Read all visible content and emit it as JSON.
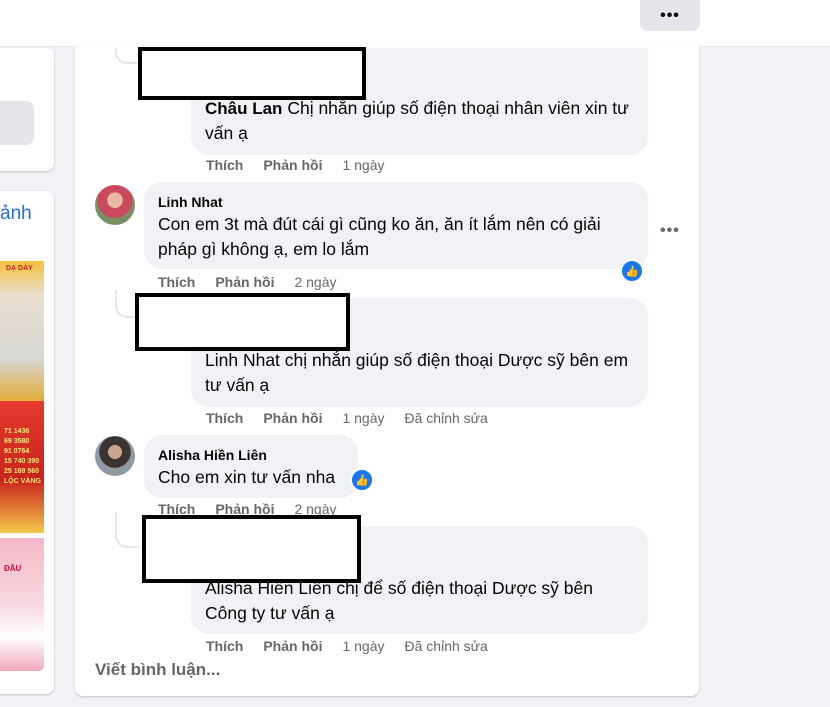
{
  "header": {
    "more_label": "•••"
  },
  "left_panel": {
    "card_text": "ảnh",
    "ads": [
      {
        "text": "DẠ DÀY"
      },
      {
        "text": "71 1436\n69 3580\n91 0764\n15 740 390\n25 169 560\nLỘC VÀNG"
      },
      {
        "text": "ĐẦU"
      }
    ]
  },
  "comments": [
    {
      "name": "Châu Lan",
      "text": "Chị nhắn giúp số điện thoại nhân viên xin tư vấn ạ",
      "actions": [
        "Thích",
        "Phản hồi"
      ],
      "time": "1 ngày"
    },
    {
      "name": "Linh Nhat",
      "text": "Con em 3t mà đút cái gì cũng ko ăn, ăn ít lắm nên có giải pháp gì không ạ, em lo lắm",
      "actions": [
        "Thích",
        "Phản hồi"
      ],
      "time": "2 ngày",
      "options_label": "•••"
    },
    {
      "text": "Linh Nhat chị nhắn giúp số điện thoại Dược sỹ bên em tư vấn ạ",
      "actions": [
        "Thích",
        "Phản hồi"
      ],
      "time": "1 ngày",
      "edited": "Đã chỉnh sửa"
    },
    {
      "name": "Alisha Hiền Liên",
      "text": "Cho em xin tư vấn nha",
      "actions": [
        "Thích",
        "Phản hồi"
      ],
      "time": "2 ngày"
    },
    {
      "text": "Alisha Hiền Liên chị để số điện thoại Dược sỹ bên Công ty tư vấn ạ",
      "actions": [
        "Thích",
        "Phản hồi"
      ],
      "time": "1 ngày",
      "edited": "Đã chỉnh sửa"
    }
  ],
  "write_comment": {
    "placeholder": "Viết bình luận..."
  },
  "icons": {
    "like": "like-icon",
    "more": "more-dots-icon"
  },
  "colors": {
    "accent": "#1877f2",
    "secondary_text": "#65676b",
    "bubble": "#f0f2f5"
  }
}
